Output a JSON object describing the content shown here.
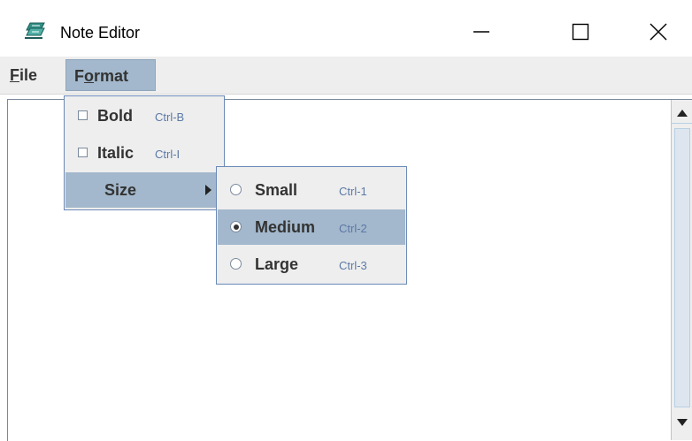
{
  "window": {
    "title": "Note Editor",
    "controls": {
      "minimize_icon": "minimize-icon",
      "maximize_icon": "maximize-icon",
      "close_icon": "close-icon"
    }
  },
  "menubar": {
    "file": {
      "mnemonic": "F",
      "rest": "ile"
    },
    "format": {
      "pre": "F",
      "mnemonic": "o",
      "rest": "rmat"
    }
  },
  "format_menu": {
    "items": [
      {
        "label": "Bold",
        "accelerator": "Ctrl-B",
        "checked": false
      },
      {
        "label": "Italic",
        "accelerator": "Ctrl-I",
        "checked": false
      },
      {
        "label": "Size",
        "submenu": true,
        "highlighted": true
      }
    ]
  },
  "size_menu": {
    "items": [
      {
        "label": "Small",
        "accelerator": "Ctrl-1",
        "selected": false
      },
      {
        "label": "Medium",
        "accelerator": "Ctrl-2",
        "selected": true
      },
      {
        "label": "Large",
        "accelerator": "Ctrl-3",
        "selected": false
      }
    ]
  },
  "colors": {
    "menu_highlight": "#a3b8cc",
    "popup_border": "#6b89b8",
    "accelerator_text": "#5b79a6",
    "menubar_bg": "#eeeeee"
  }
}
